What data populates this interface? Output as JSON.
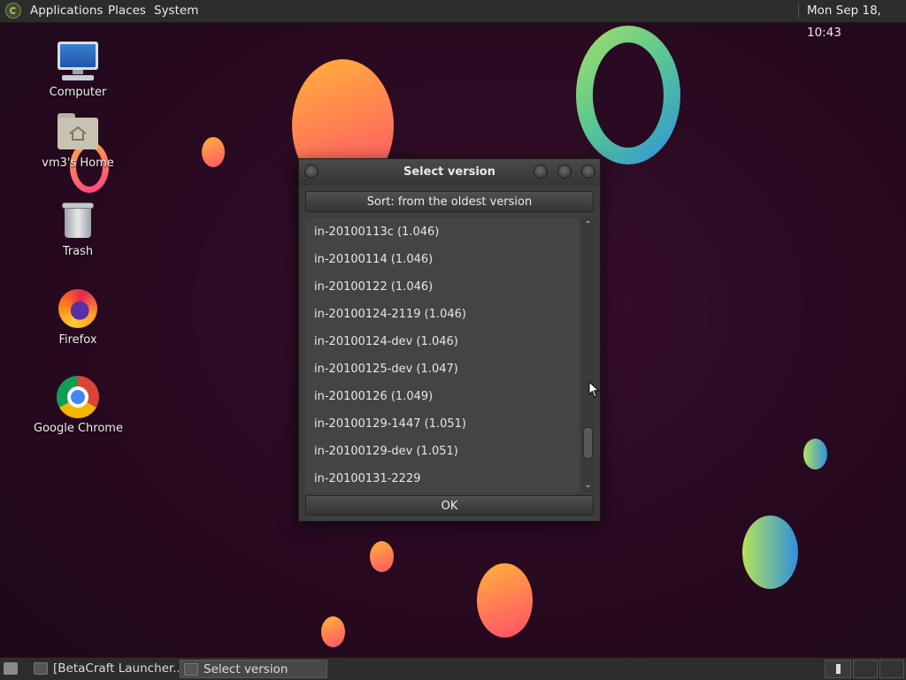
{
  "top_panel": {
    "menus": [
      "Applications",
      "Places",
      "System"
    ],
    "clock": "Mon Sep 18, 10:43"
  },
  "desktop": {
    "icons": [
      {
        "label": "Computer",
        "icon": "computer-icon"
      },
      {
        "label": "vm3's Home",
        "icon": "home-folder-icon"
      },
      {
        "label": "Trash",
        "icon": "trash-icon"
      },
      {
        "label": "Firefox",
        "icon": "firefox-icon"
      },
      {
        "label": "Google Chrome",
        "icon": "chrome-icon"
      }
    ]
  },
  "dialog": {
    "title": "Select version",
    "sort_button": "Sort: from the oldest version",
    "versions": [
      "in-20100113c (1.046)",
      "in-20100114 (1.046)",
      "in-20100122 (1.046)",
      "in-20100124-2119 (1.046)",
      "in-20100124-dev (1.046)",
      "in-20100125-dev (1.047)",
      "in-20100126 (1.049)",
      "in-20100129-1447 (1.051)",
      "in-20100129-dev (1.051)",
      "in-20100131-2229"
    ],
    "ok_button": "OK"
  },
  "taskbar": {
    "tasks": [
      {
        "label": "[BetaCraft Launcher...",
        "active": false
      },
      {
        "label": "Select version",
        "active": true
      }
    ]
  },
  "colors": {
    "panel": "#2c2c2c",
    "dialog_bg": "#3d3d3d",
    "list_bg": "#444444",
    "desktop_bg": "#2a0a22"
  }
}
